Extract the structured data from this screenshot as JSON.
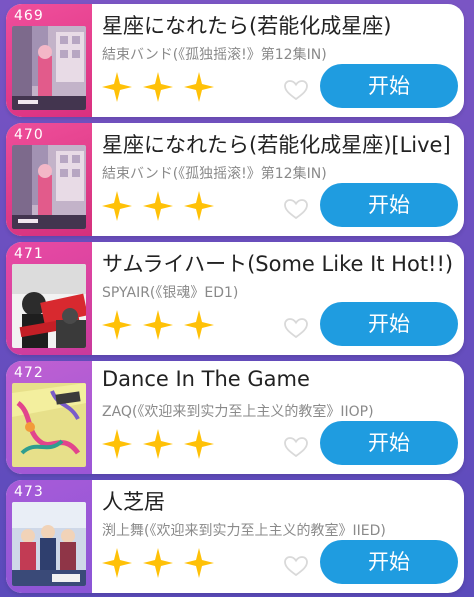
{
  "colors": {
    "start_button": "#1f9ce0",
    "star": "#ffc107",
    "rank_pink": "#e2388a",
    "rank_purple": "#9a5ad8",
    "background": "#6a4fc0"
  },
  "songs": [
    {
      "rank": "469",
      "title": "星座になれたら(若能化成星座)",
      "subtitle": "結束バンド(《孤独摇滚!》第12集IN)",
      "stars": 3,
      "cover_icon": "album-cover-kessoku-band",
      "start_label": "开始"
    },
    {
      "rank": "470",
      "title": "星座になれたら(若能化成星座)[Live]",
      "subtitle": "結束バンド(《孤独摇滚!》第12集IN)",
      "stars": 3,
      "cover_icon": "album-cover-kessoku-band",
      "start_label": "开始"
    },
    {
      "rank": "471",
      "title": "サムライハート(Some Like It Hot!!)",
      "subtitle": "SPYAIR(《银魂》ED1)",
      "stars": 3,
      "cover_icon": "album-cover-spyair",
      "start_label": "开始"
    },
    {
      "rank": "472",
      "title": "Dance In The Game",
      "subtitle": "ZAQ(《欢迎来到实力至上主义的教室》IIOP)",
      "stars": 3,
      "cover_icon": "album-cover-zaq",
      "start_label": "开始"
    },
    {
      "rank": "473",
      "title": "人芝居",
      "subtitle": "渕上舞(《欢迎来到实力至上主义的教室》IIED)",
      "stars": 3,
      "cover_icon": "album-cover-fuchigami-mai",
      "start_label": "开始"
    }
  ]
}
